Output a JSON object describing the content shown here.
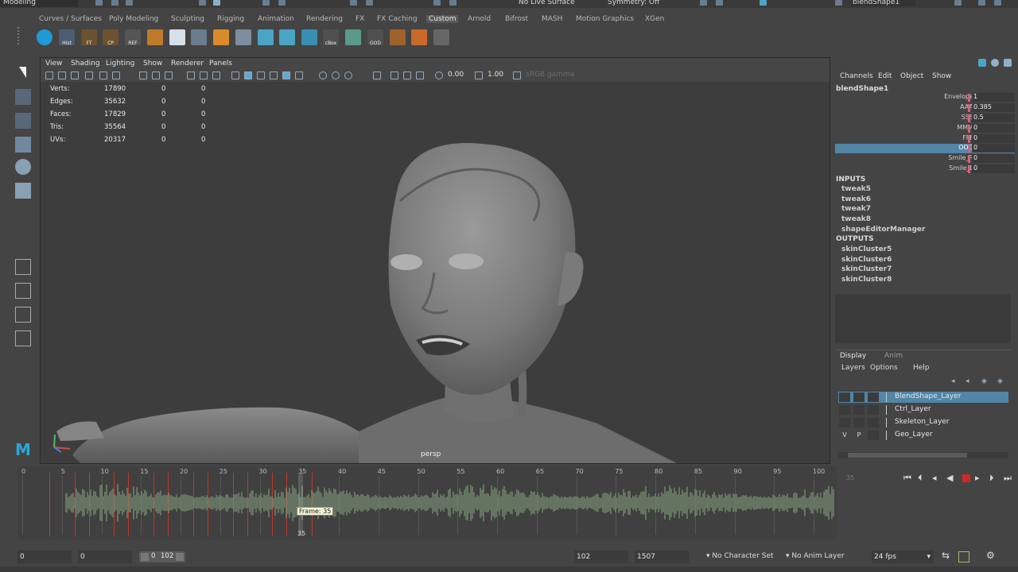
{
  "status_line": {
    "mode": "Modeling",
    "live_surface": "No Live Surface",
    "symmetry": "Symmetry: Off",
    "object_field": "blendShape1"
  },
  "shelf_tabs": [
    "Curves / Surfaces",
    "Poly Modeling",
    "Sculpting",
    "Rigging",
    "Animation",
    "Rendering",
    "FX",
    "FX Caching",
    "Custom",
    "Arnold",
    "Bifrost",
    "MASH",
    "Motion Graphics",
    "XGen"
  ],
  "active_shelf_tab": "Custom",
  "shelf_icons": [
    {
      "icon": "cube-icon",
      "label": ""
    },
    {
      "icon": "hist-icon",
      "label": "Hist"
    },
    {
      "icon": "freeze-transform-icon",
      "label": "FT"
    },
    {
      "icon": "center-pivot-icon",
      "label": "CP"
    },
    {
      "icon": "reference-icon",
      "label": "REF"
    },
    {
      "icon": "tool-icon",
      "label": ""
    },
    {
      "icon": "bone-icon",
      "label": ""
    },
    {
      "icon": "grid-icon",
      "label": ""
    },
    {
      "icon": "cylinder-icon",
      "label": ""
    },
    {
      "icon": "transform-icon",
      "label": ""
    },
    {
      "icon": "brush-icon",
      "label": ""
    },
    {
      "icon": "paint-icon",
      "label": ""
    },
    {
      "icon": "window-icon",
      "label": ""
    },
    {
      "icon": "cbox-icon",
      "label": "cBox"
    },
    {
      "icon": "checker-icon",
      "label": ""
    },
    {
      "icon": "god-icon",
      "label": "GOD"
    },
    {
      "icon": "wave-tool-icon",
      "label": ""
    },
    {
      "icon": "render-icon",
      "label": ""
    },
    {
      "icon": "maya-m-icon",
      "label": ""
    }
  ],
  "viewport": {
    "menu": [
      "View",
      "Shading",
      "Lighting",
      "Show",
      "Renderer",
      "Panels"
    ],
    "exposure": "0.00",
    "gamma": "1.00",
    "color_space": "sRGB gamma",
    "camera": "persp",
    "hud": [
      {
        "label": "Verts:",
        "v1": "17890",
        "v2": "0",
        "v3": "0"
      },
      {
        "label": "Edges:",
        "v1": "35632",
        "v2": "0",
        "v3": "0"
      },
      {
        "label": "Faces:",
        "v1": "17829",
        "v2": "0",
        "v3": "0"
      },
      {
        "label": "Tris:",
        "v1": "35564",
        "v2": "0",
        "v3": "0"
      },
      {
        "label": "UVs:",
        "v1": "20317",
        "v2": "0",
        "v3": "0"
      }
    ]
  },
  "channel_box": {
    "menu": [
      "Channels",
      "Edit",
      "Object",
      "Show"
    ],
    "object": "blendShape1",
    "attributes": [
      {
        "name": "Envelope",
        "value": "1"
      },
      {
        "name": "AAA",
        "value": "0.385"
      },
      {
        "name": "SSS",
        "value": "0.5"
      },
      {
        "name": "MMM",
        "value": "0"
      },
      {
        "name": "FFF",
        "value": "0"
      },
      {
        "name": "OOO",
        "value": "0"
      },
      {
        "name": "Smile_R",
        "value": "0"
      },
      {
        "name": "Smile_L",
        "value": "0"
      }
    ],
    "selected_attribute": "OOO",
    "inputs_label": "INPUTS",
    "inputs": [
      "tweak5",
      "tweak6",
      "tweak7",
      "tweak8",
      "shapeEditorManager"
    ],
    "outputs_label": "OUTPUTS",
    "outputs": [
      "skinCluster5",
      "skinCluster6",
      "skinCluster7",
      "skinCluster8"
    ]
  },
  "layer_editor": {
    "tabs": [
      "Display",
      "Anim"
    ],
    "active_tab": "Display",
    "menu": [
      "Layers",
      "Options",
      "Help"
    ],
    "layers": [
      {
        "name": "BlendShape_Layer",
        "v": "",
        "p": "",
        "selected": true
      },
      {
        "name": "Ctrl_Layer",
        "v": "",
        "p": "",
        "selected": false
      },
      {
        "name": "Skeleton_Layer",
        "v": "",
        "p": "",
        "selected": false
      },
      {
        "name": "Geo_Layer",
        "v": "V",
        "p": "P",
        "selected": false
      }
    ]
  },
  "time_slider": {
    "ticks": [
      "0",
      "5",
      "10",
      "15",
      "20",
      "25",
      "30",
      "35",
      "40",
      "45",
      "50",
      "55",
      "60",
      "65",
      "70",
      "75",
      "80",
      "85",
      "90",
      "95",
      "100"
    ],
    "current_frame": "35",
    "frame_tooltip": "Frame: 35",
    "side_field": "35",
    "key_frames": [
      5,
      10,
      15,
      20,
      25,
      30,
      35
    ]
  },
  "range_slider": {
    "start": "0",
    "anim_start": "0",
    "range_start": "0",
    "range_end": "102",
    "end": "102",
    "anim_end": "1507",
    "character_set": "No Character Set",
    "anim_layer": "No Anim Layer",
    "fps": "24 fps"
  },
  "colors": {
    "accent": "#5285a6",
    "key": "#c0392b",
    "waveform": "#7e9878"
  }
}
